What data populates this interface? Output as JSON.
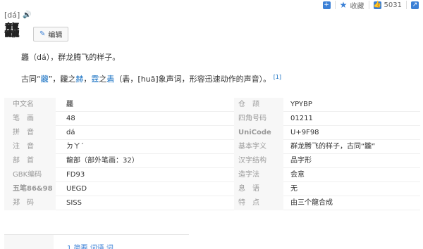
{
  "topbar": {
    "add_icon": "plus-icon",
    "favorite_label": "收藏",
    "like_count": "5031"
  },
  "entry": {
    "pinyin": "[dá]",
    "headword": "龘",
    "edit_label": "编辑",
    "definition_1": "龘（dá），群龙腾飞的样子。",
    "definition_2_prefix": "古同“",
    "definition_2_link1": "龖",
    "definition_2_mid1": "”，龖之",
    "definition_2_link2": "赫",
    "definition_2_mid2": "，",
    "definition_2_link3": "霆",
    "definition_2_mid3": "之",
    "definition_2_link4": "砉",
    "definition_2_suffix": "（砉，[huā]象声词，形容迅速动作的声音）。",
    "footnote": "[1]"
  },
  "table": [
    {
      "l1": "中文名",
      "v1": "龘",
      "l2": "仓　颉",
      "v2": "YPYBP"
    },
    {
      "l1": "笔　画",
      "v1": "48",
      "l2": "四角号码",
      "v2": "01211"
    },
    {
      "l1": "拼　音",
      "v1": "dá",
      "l2": "UniCode",
      "v2": "U+9F98"
    },
    {
      "l1": "注　音",
      "v1": "ㄉㄚˊ",
      "l2": "基本字义",
      "v2": "群龙腾飞的样子，古同“龖”"
    },
    {
      "l1": "部　首",
      "v1": "龍部（部外笔画：32）",
      "l2": "汉字结构",
      "v2": "品字形"
    },
    {
      "l1": "GBK编码",
      "v1": "FD93",
      "l2": "造字法",
      "v2": "会意"
    },
    {
      "l1": "五笔86&98",
      "v1": "UEGD",
      "l2": "息　语",
      "v2": "无"
    },
    {
      "l1": "郑　码",
      "v1": "SISS",
      "l2": "特　点",
      "v2": "由三个龍合成"
    }
  ],
  "bottom": {
    "partial_text": "1 简要 词语 词"
  }
}
